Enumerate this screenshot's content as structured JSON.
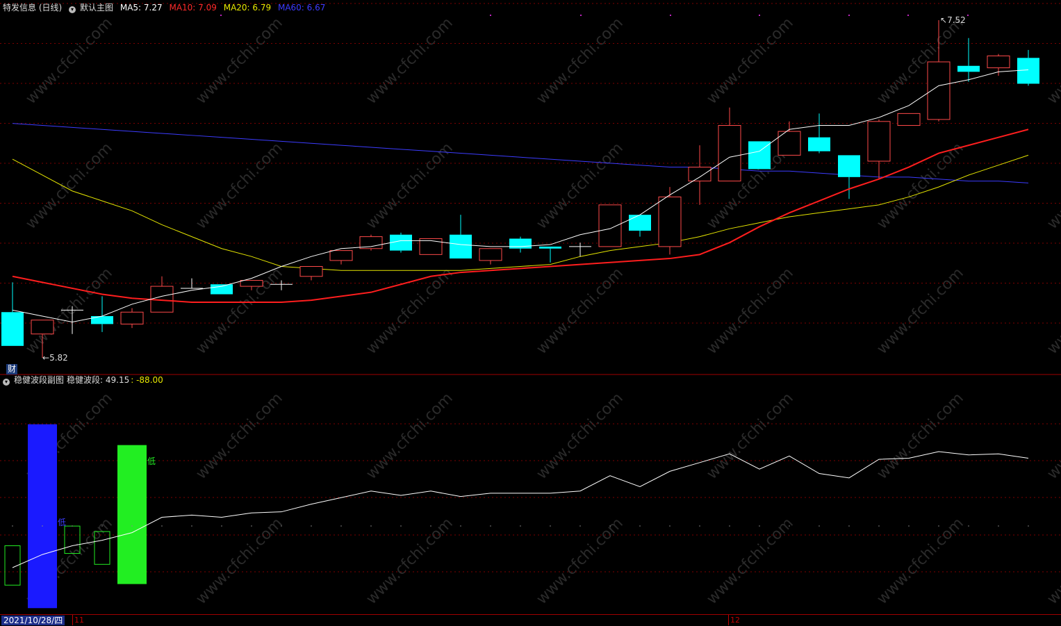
{
  "main_header": {
    "title": "特发信息 (日线)",
    "indicator_name": "默认主图",
    "ma5": "MA5: 7.27",
    "ma10": "MA10: 7.09",
    "ma20": "MA20: 6.79",
    "ma60": "MA60: 6.67"
  },
  "sub_header": {
    "indicator_name": "稳健波段副图",
    "value_label": "稳健波段: 49.15",
    "value_extra": ": -88.00"
  },
  "labels": {
    "price_high": "7.52",
    "price_low": "5.82",
    "finance_badge": "财",
    "sub_low_marker": "低",
    "sub_mid_marker": "低"
  },
  "date_axis": {
    "current_date": "2021/10/28/四",
    "month_11": "11",
    "month_12": "12"
  },
  "watermark": "www.cfchi.com",
  "colors": {
    "up": "#ff4a4a",
    "down": "#00ffff",
    "ma5": "#ffffff",
    "ma10": "#ff1e1e",
    "ma20": "#e6e600",
    "ma60": "#3c3cff",
    "grid": "#800000",
    "sub_line": "#ffffff",
    "bar_blue": "#1a1aff",
    "bar_green": "#22ee22"
  },
  "chart_data": [
    {
      "type": "candlestick",
      "title": "特发信息 (日线)",
      "ylim": [
        5.7,
        7.6
      ],
      "candles": [
        {
          "o": 6.05,
          "h": 6.2,
          "l": 5.88,
          "c": 5.88
        },
        {
          "o": 5.94,
          "h": 6.01,
          "l": 5.82,
          "c": 6.01
        },
        {
          "o": 6.06,
          "h": 6.08,
          "l": 5.94,
          "c": 6.06
        },
        {
          "o": 6.03,
          "h": 6.13,
          "l": 5.95,
          "c": 5.99
        },
        {
          "o": 5.99,
          "h": 6.07,
          "l": 5.97,
          "c": 6.05
        },
        {
          "o": 6.05,
          "h": 6.23,
          "l": 6.05,
          "c": 6.18
        },
        {
          "o": 6.17,
          "h": 6.22,
          "l": 6.17,
          "c": 6.17
        },
        {
          "o": 6.19,
          "h": 6.19,
          "l": 6.14,
          "c": 6.14
        },
        {
          "o": 6.18,
          "h": 6.2,
          "l": 6.16,
          "c": 6.21
        },
        {
          "o": 6.19,
          "h": 6.21,
          "l": 6.16,
          "c": 6.19
        },
        {
          "o": 6.23,
          "h": 6.28,
          "l": 6.21,
          "c": 6.28
        },
        {
          "o": 6.31,
          "h": 6.36,
          "l": 6.29,
          "c": 6.36
        },
        {
          "o": 6.37,
          "h": 6.44,
          "l": 6.36,
          "c": 6.43
        },
        {
          "o": 6.44,
          "h": 6.45,
          "l": 6.35,
          "c": 6.36
        },
        {
          "o": 6.34,
          "h": 6.42,
          "l": 6.34,
          "c": 6.42
        },
        {
          "o": 6.44,
          "h": 6.54,
          "l": 6.32,
          "c": 6.32
        },
        {
          "o": 6.31,
          "h": 6.37,
          "l": 6.29,
          "c": 6.37
        },
        {
          "o": 6.42,
          "h": 6.43,
          "l": 6.35,
          "c": 6.37
        },
        {
          "o": 6.38,
          "h": 6.38,
          "l": 6.3,
          "c": 6.37
        },
        {
          "o": 6.38,
          "h": 6.4,
          "l": 6.33,
          "c": 6.38
        },
        {
          "o": 6.38,
          "h": 6.59,
          "l": 6.38,
          "c": 6.59
        },
        {
          "o": 6.54,
          "h": 6.54,
          "l": 6.43,
          "c": 6.46
        },
        {
          "o": 6.38,
          "h": 6.68,
          "l": 6.34,
          "c": 6.63
        },
        {
          "o": 6.71,
          "h": 6.89,
          "l": 6.59,
          "c": 6.78
        },
        {
          "o": 6.71,
          "h": 7.08,
          "l": 6.71,
          "c": 6.99
        },
        {
          "o": 6.91,
          "h": 6.91,
          "l": 6.77,
          "c": 6.77
        },
        {
          "o": 6.84,
          "h": 7.01,
          "l": 6.85,
          "c": 6.96
        },
        {
          "o": 6.93,
          "h": 7.05,
          "l": 6.85,
          "c": 6.86
        },
        {
          "o": 6.84,
          "h": 6.84,
          "l": 6.62,
          "c": 6.73
        },
        {
          "o": 6.81,
          "h": 7.02,
          "l": 6.72,
          "c": 7.01
        },
        {
          "o": 6.99,
          "h": 7.05,
          "l": 6.99,
          "c": 7.05
        },
        {
          "o": 7.02,
          "h": 7.52,
          "l": 7.01,
          "c": 7.31
        },
        {
          "o": 7.29,
          "h": 7.43,
          "l": 7.21,
          "c": 7.26
        },
        {
          "o": 7.28,
          "h": 7.35,
          "l": 7.24,
          "c": 7.34
        },
        {
          "o": 7.33,
          "h": 7.37,
          "l": 7.19,
          "c": 7.2
        }
      ],
      "ma5": [
        6.06,
        6.03,
        6.0,
        6.03,
        6.09,
        6.13,
        6.16,
        6.18,
        6.22,
        6.28,
        6.33,
        6.37,
        6.38,
        6.41,
        6.41,
        6.39,
        6.38,
        6.38,
        6.39,
        6.44,
        6.47,
        6.54,
        6.64,
        6.73,
        6.83,
        6.86,
        6.97,
        6.99,
        6.99,
        7.03,
        7.09,
        7.19,
        7.22,
        7.26,
        7.27
      ],
      "ma10": [
        6.23,
        6.2,
        6.17,
        6.14,
        6.12,
        6.11,
        6.1,
        6.1,
        6.1,
        6.1,
        6.11,
        6.13,
        6.15,
        6.19,
        6.23,
        6.25,
        6.26,
        6.27,
        6.28,
        6.29,
        6.3,
        6.31,
        6.32,
        6.34,
        6.4,
        6.48,
        6.55,
        6.61,
        6.67,
        6.72,
        6.78,
        6.85,
        6.89,
        6.93,
        6.97
      ],
      "ma20": [
        6.82,
        6.74,
        6.66,
        6.61,
        6.56,
        6.49,
        6.43,
        6.37,
        6.33,
        6.28,
        6.27,
        6.26,
        6.26,
        6.26,
        6.26,
        6.26,
        6.27,
        6.28,
        6.29,
        6.33,
        6.36,
        6.38,
        6.4,
        6.43,
        6.47,
        6.5,
        6.53,
        6.55,
        6.57,
        6.59,
        6.63,
        6.68,
        6.74,
        6.79,
        6.84
      ],
      "ma60": [
        7.0,
        6.99,
        6.98,
        6.97,
        6.96,
        6.95,
        6.94,
        6.93,
        6.92,
        6.91,
        6.9,
        6.89,
        6.88,
        6.87,
        6.86,
        6.85,
        6.84,
        6.83,
        6.82,
        6.81,
        6.8,
        6.79,
        6.78,
        6.78,
        6.77,
        6.76,
        6.76,
        6.75,
        6.74,
        6.73,
        6.73,
        6.72,
        6.71,
        6.71,
        6.7
      ]
    },
    {
      "type": "line",
      "title": "稳健波段副图",
      "ylim": [
        -100,
        100
      ],
      "values": [
        -60,
        -48,
        -40,
        -35,
        -28,
        -14,
        -12,
        -14,
        -10,
        -9,
        -2,
        4,
        10,
        6,
        10,
        5,
        8,
        8,
        8,
        10,
        24,
        14,
        28,
        36,
        44,
        30,
        42,
        26,
        22,
        39,
        40,
        46,
        43,
        44,
        40
      ],
      "low_boxes": [
        {
          "index": 0,
          "top": -40,
          "bottom": -76
        },
        {
          "index": 2,
          "top": -22,
          "bottom": -47
        },
        {
          "index": 3,
          "top": -27,
          "bottom": -57
        }
      ],
      "blue_bar": {
        "index": 1,
        "top": 71,
        "bottom": -97
      },
      "green_bar": {
        "index": 4,
        "top": 52,
        "bottom": -75
      }
    }
  ]
}
